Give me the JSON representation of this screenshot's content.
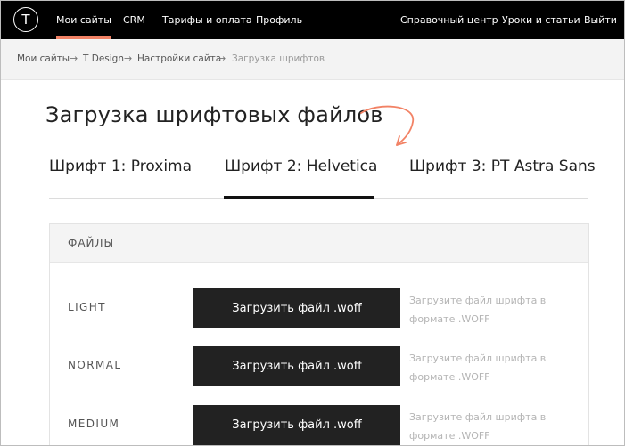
{
  "topnav": {
    "logo_letter": "T",
    "items": [
      "Мои сайты",
      "CRM",
      "Тарифы и оплата",
      "Профиль"
    ],
    "right_items": [
      "Справочный центр",
      "Уроки и статьи",
      "Выйти"
    ],
    "accent_color": "#f28265"
  },
  "breadcrumbs": {
    "items": [
      "Мои сайты",
      "T Design",
      "Настройки сайта",
      "Загрузка шрифтов"
    ],
    "separator": "→"
  },
  "page": {
    "title": "Загрузка шрифтовых файлов",
    "annotation_icon": "curved-arrow-icon"
  },
  "tabs": [
    {
      "label": "Шрифт 1: Proxima",
      "active": false
    },
    {
      "label": "Шрифт 2: Helvetica",
      "active": true
    },
    {
      "label": "Шрифт 3: PT Astra Sans",
      "active": false
    }
  ],
  "files": {
    "header": "ФАЙЛЫ",
    "rows": [
      {
        "weight": "LIGHT",
        "button": "Загрузить файл .woff",
        "hint": "Загрузите файл шрифта в формате .WOFF"
      },
      {
        "weight": "NORMAL",
        "button": "Загрузить файл .woff",
        "hint": "Загрузите файл шрифта в формате .WOFF"
      },
      {
        "weight": "MEDIUM",
        "button": "Загрузить файл .woff",
        "hint": "Загрузите файл шрифта в формате .WOFF"
      }
    ]
  }
}
